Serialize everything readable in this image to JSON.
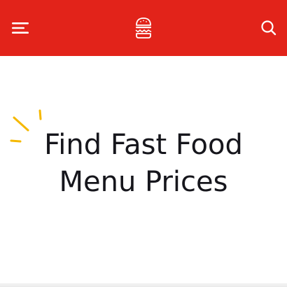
{
  "header": {
    "background_color": "#e2231a",
    "menu_icon": "hamburger-menu-icon",
    "logo_icon": "burger-logo-icon",
    "search_icon": "search-icon"
  },
  "hero": {
    "title_line_1": "Find Fast Food",
    "title_line_2": "Menu Prices",
    "decoration_icon": "sparkle-accent-icon",
    "accent_color": "#f5b800",
    "text_color": "#16161c"
  }
}
